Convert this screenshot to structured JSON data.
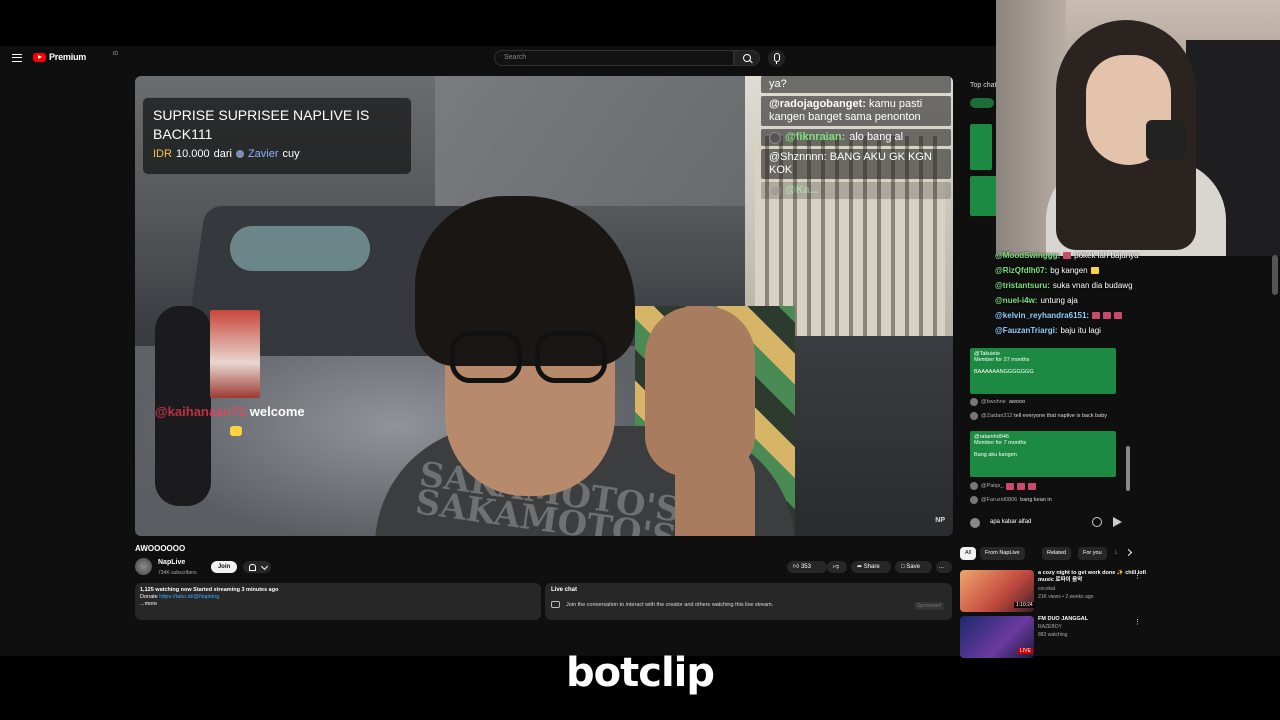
{
  "app": {
    "logo_text": "Premium",
    "logo_sup": "ID"
  },
  "search": {
    "placeholder": "Search"
  },
  "video": {
    "donation": {
      "title": "SUPRISE SUPRISEE NAPLIVE IS BACK111",
      "currency": "IDR",
      "amount": "10.000",
      "from_word": "dari",
      "donor": "Zavier",
      "suffix": "cuy"
    },
    "follower": {
      "name": "@kaihanaan72",
      "message": "welcome"
    },
    "overlay_chat": [
      {
        "name": "",
        "text": "ya?"
      },
      {
        "name": "@radojagobanget:",
        "text": "kamu pasti kangen banget sama penonton"
      },
      {
        "name": "@fiknraian:",
        "text": "alo bang al"
      },
      {
        "name": "@Shznnnn:",
        "text": "BANG AKU GK KGN KOK"
      },
      {
        "name": "@Ka...",
        "text": ""
      }
    ],
    "corner_mark": "NP"
  },
  "meta": {
    "title": "AWOOOOOO",
    "channel": "NapLive",
    "subscribers": "734K subscribers",
    "join_label": "Join",
    "likes": "353",
    "share_label": "Share",
    "save_label": "Save",
    "more_label": "...",
    "desc_line1": "1,125 watching now  Started streaming 3 minutes ago",
    "desc_donate": "Donate",
    "desc_link": "https://tako.id/@Napking",
    "desc_more": "...more",
    "live_chat_title": "Live chat",
    "live_chat_text": "Join the conversation to interact with the creator and others watching this live stream.",
    "live_chat_tag": "Sponsored"
  },
  "chat": {
    "header": "Top chat",
    "input_value": "apa kabar alfad",
    "member1_name": "@Takuiete",
    "member1_sub": "Member for 27 months",
    "member1_text": "BAAAAAANGGGGGGG",
    "line1_name": "@bwohne",
    "line1_text": "awooo",
    "line2_name": "@Zaidan312",
    "line2_text": "tell everyone that naplive is back baby",
    "member2_name": "@ratamhd946",
    "member2_sub": "Member for 7 months",
    "member2_text": "Bang aku kangen",
    "line3_name": "@Paiqs_",
    "line4_name": "@Faruzid0806",
    "line4_text": "bang kean in"
  },
  "float_chat": [
    {
      "name": "@MoodSwinggg:",
      "text": "pokek lah bajunya",
      "color": "green"
    },
    {
      "name": "@RizQfdlh07:",
      "text": "bg kangen",
      "color": "green"
    },
    {
      "name": "@tristantsuru:",
      "text": "suka vnan dia budawg",
      "color": "green"
    },
    {
      "name": "@nuel-i4w:",
      "text": "untung aja",
      "color": "green"
    },
    {
      "name": "@kelvin_reyhandra6151:",
      "text": "",
      "color": "blue"
    },
    {
      "name": "@FauzanTriargi:",
      "text": "baju itu lagi",
      "color": "blue"
    }
  ],
  "recs": {
    "chips": [
      "All",
      "From NapLive",
      "Related",
      "For you",
      "L"
    ],
    "items": [
      {
        "title": "a cozy night to get work done ✨ chill lofi music 로파이 음악",
        "channel": "cocokat",
        "meta": "21K views • 2 weeks ago",
        "duration": "1:10:24"
      },
      {
        "title": "FM DUO JANGGAL",
        "channel": "RAZEBOY",
        "meta": "883 watching",
        "duration": "LIVE"
      }
    ]
  },
  "caption": {
    "text": "botclip"
  },
  "colors": {
    "accent_red": "#ff0000",
    "member_green": "#1c8a42",
    "link_blue": "#3ea6ff"
  }
}
